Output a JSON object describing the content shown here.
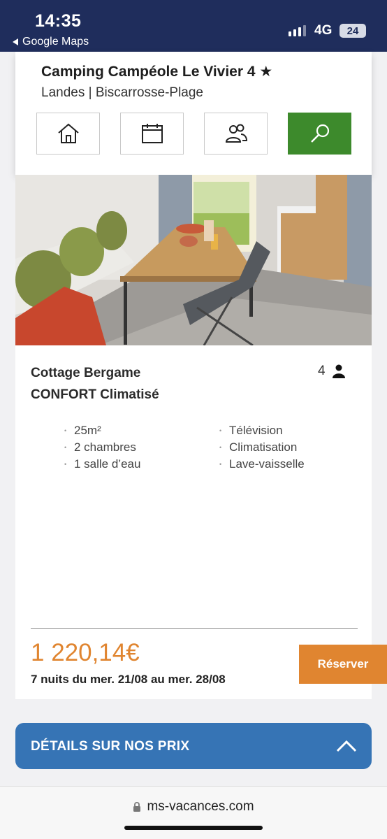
{
  "status_bar": {
    "time": "14:35",
    "back_label": "Google Maps",
    "network": "4G",
    "battery": "24"
  },
  "header": {
    "title": "Camping Campéole Le Vivier 4 ★",
    "subtitle": "Landes | Biscarrosse-Plage",
    "nav_icons": [
      "home-icon",
      "calendar-icon",
      "group-icon",
      "search-icon"
    ],
    "active_color": "#3d8a2c"
  },
  "listing": {
    "name_line1": "Cottage Bergame",
    "name_line2": "CONFORT Climatisé",
    "capacity": "4",
    "features_left": [
      "25m²",
      "2 chambres",
      "1 salle d’eau"
    ],
    "features_right": [
      "Télévision",
      "Climatisation",
      "Lave-vaisselle"
    ],
    "price": "1 220,14€",
    "period": "7 nuits du mer. 21/08 au mer. 28/08",
    "reserve_label": "Réserver",
    "accent_color": "#e08530"
  },
  "details": {
    "label": "DÉTAILS SUR NOS PRIX",
    "color": "#3674b5"
  },
  "browser": {
    "url": "ms-vacances.com"
  }
}
